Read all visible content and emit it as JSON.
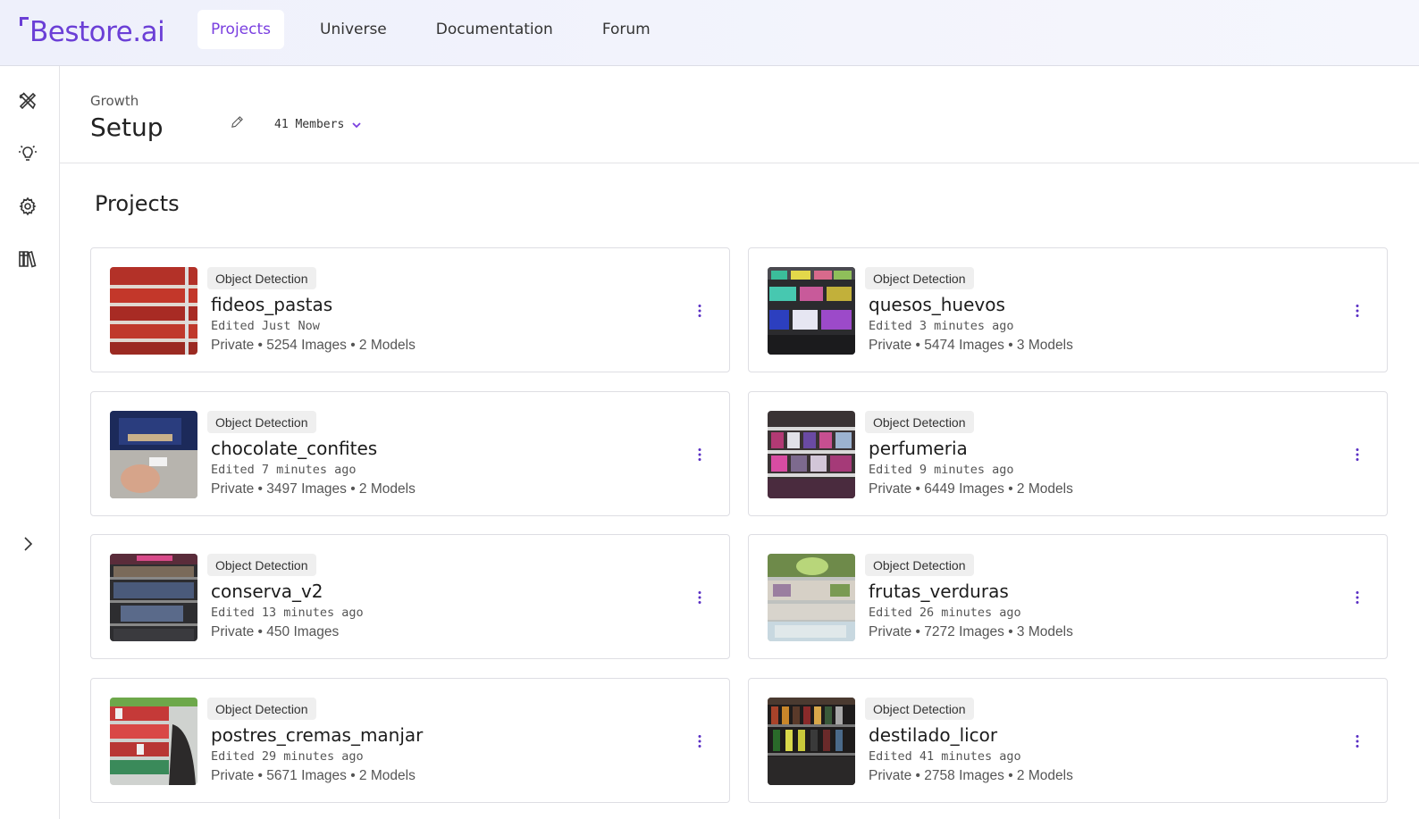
{
  "brand": {
    "name": "Bestore.ai",
    "color": "#6b3fd6"
  },
  "nav": {
    "items": [
      {
        "label": "Projects",
        "active": true
      },
      {
        "label": "Universe",
        "active": false
      },
      {
        "label": "Documentation",
        "active": false
      },
      {
        "label": "Forum",
        "active": false
      }
    ]
  },
  "rail": {
    "icons": [
      "tools-icon",
      "lightbulb-icon",
      "gear-icon",
      "library-icon",
      "chevron-right-icon"
    ]
  },
  "header": {
    "breadcrumb": "Growth",
    "title": "Setup",
    "members": "41 Members"
  },
  "section_title": "Projects",
  "projects": [
    {
      "type": "Object Detection",
      "name": "fideos_pastas",
      "edited": "Edited Just Now",
      "meta": "Private • 5254 Images • 2 Models"
    },
    {
      "type": "Object Detection",
      "name": "quesos_huevos",
      "edited": "Edited 3 minutes ago",
      "meta": "Private • 5474 Images • 3 Models"
    },
    {
      "type": "Object Detection",
      "name": "chocolate_confites",
      "edited": "Edited 7 minutes ago",
      "meta": "Private • 3497 Images • 2 Models"
    },
    {
      "type": "Object Detection",
      "name": "perfumeria",
      "edited": "Edited 9 minutes ago",
      "meta": "Private • 6449 Images • 2 Models"
    },
    {
      "type": "Object Detection",
      "name": "conserva_v2",
      "edited": "Edited 13 minutes ago",
      "meta": "Private • 450 Images"
    },
    {
      "type": "Object Detection",
      "name": "frutas_verduras",
      "edited": "Edited 26 minutes ago",
      "meta": "Private • 7272 Images • 3 Models"
    },
    {
      "type": "Object Detection",
      "name": "postres_cremas_manjar",
      "edited": "Edited 29 minutes ago",
      "meta": "Private • 5671 Images • 2 Models"
    },
    {
      "type": "Object Detection",
      "name": "destilado_licor",
      "edited": "Edited 41 minutes ago",
      "meta": "Private • 2758 Images • 2 Models"
    }
  ]
}
